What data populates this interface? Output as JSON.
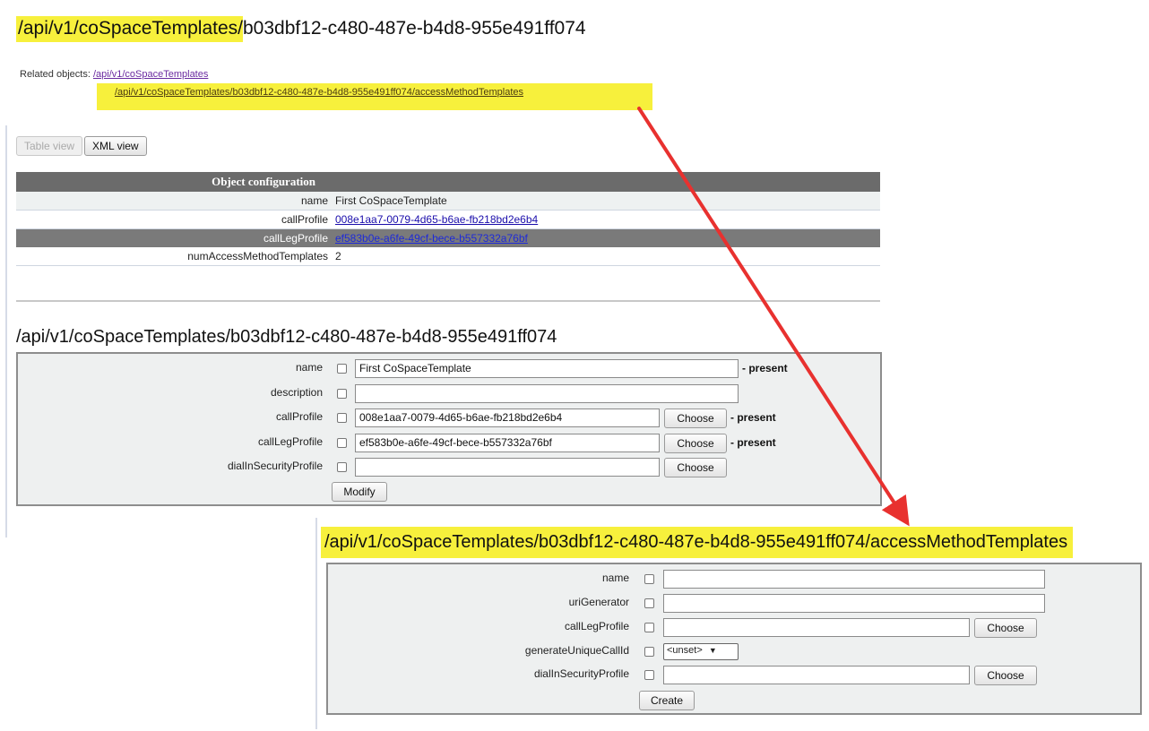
{
  "header": {
    "title_highlight": "/api/v1/coSpaceTemplates/",
    "title_rest": "b03dbf12-c480-487e-b4d8-955e491ff074"
  },
  "related": {
    "label": "Related objects:",
    "link1": "/api/v1/coSpaceTemplates",
    "link2": "/api/v1/coSpaceTemplates/b03dbf12-c480-487e-b4d8-955e491ff074/accessMethodTemplates"
  },
  "viewbar": {
    "table_view": "Table view",
    "xml_view": "XML view"
  },
  "object_config": {
    "header": "Object configuration",
    "rows": [
      {
        "key": "name",
        "value": "First CoSpaceTemplate"
      },
      {
        "key": "callProfile",
        "value": "008e1aa7-0079-4d65-b6ae-fb218bd2e6b4"
      },
      {
        "key": "callLegProfile",
        "value": "ef583b0e-a6fe-49cf-bece-b557332a76bf"
      },
      {
        "key": "numAccessMethodTemplates",
        "value": "2"
      }
    ]
  },
  "modify_form": {
    "title": "/api/v1/coSpaceTemplates/b03dbf12-c480-487e-b4d8-955e491ff074",
    "fields": [
      {
        "label": "name",
        "value": "First CoSpaceTemplate",
        "status": "- present"
      },
      {
        "label": "description",
        "value": ""
      },
      {
        "label": "callProfile",
        "value": "008e1aa7-0079-4d65-b6ae-fb218bd2e6b4",
        "status": "- present"
      },
      {
        "label": "callLegProfile",
        "value": "ef583b0e-a6fe-49cf-bece-b557332a76bf",
        "status": "- present"
      },
      {
        "label": "dialInSecurityProfile",
        "value": ""
      }
    ],
    "choose_label": "Choose",
    "submit_label": "Modify"
  },
  "create_form": {
    "title": "/api/v1/coSpaceTemplates/b03dbf12-c480-487e-b4d8-955e491ff074/accessMethodTemplates",
    "fields": [
      {
        "label": "name",
        "value": ""
      },
      {
        "label": "uriGenerator",
        "value": ""
      },
      {
        "label": "callLegProfile",
        "value": ""
      },
      {
        "label": "generateUniqueCallId",
        "select_value": "<unset>"
      },
      {
        "label": "dialInSecurityProfile",
        "value": ""
      }
    ],
    "choose_label": "Choose",
    "submit_label": "Create"
  },
  "colors": {
    "highlight": "#f7f03c",
    "arrow": "#e8312f",
    "link": "#1a0dab"
  }
}
